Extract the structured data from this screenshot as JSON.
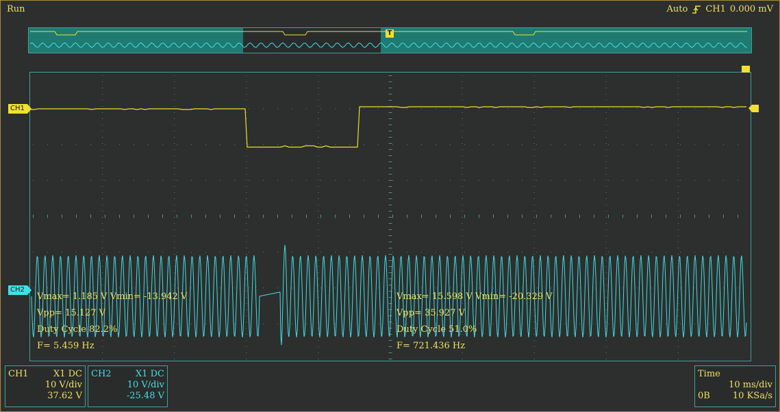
{
  "status": {
    "run": "Run"
  },
  "trigger": {
    "mode": "Auto",
    "source": "CH1",
    "level": "0.000 mV",
    "marker": "T"
  },
  "channels": {
    "ch1": {
      "tag": "CH1",
      "color": "#f0e030"
    },
    "ch2": {
      "tag": "CH2",
      "color": "#40e0e8"
    }
  },
  "measurements": {
    "left": {
      "vmax_vmin": "Vmax= 1.185 V  Vmin= -13.942 V",
      "vpp": "Vpp= 15.127 V",
      "duty": "Duty Cycle 82.2%",
      "freq": "F= 5.459 Hz"
    },
    "right": {
      "vmax_vmin": "Vmax= 15.598 V  Vmin= -20.329 V",
      "vpp": "Vpp= 35.927 V",
      "duty": "Duty Cycle 51.0%",
      "freq": "F= 721.436 Hz"
    }
  },
  "panels": {
    "ch1": {
      "name": "CH1",
      "coupling": "X1  DC",
      "scale": "10 V/div",
      "offset": "37.62 V"
    },
    "ch2": {
      "name": "CH2",
      "coupling": "X1  DC",
      "scale": "10 V/div",
      "offset": "-25.48 V"
    },
    "time": {
      "name": "Time",
      "scale": "10 ms/div",
      "memory": "0B",
      "rate": "10 KSa/s"
    }
  },
  "colors": {
    "ch1": "#f0e030",
    "ch2": "#40e0e8",
    "grid": "#3fa0a0",
    "background": "#2c2f2d"
  }
}
